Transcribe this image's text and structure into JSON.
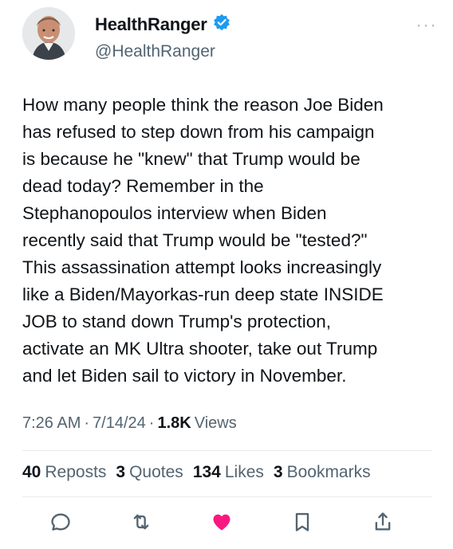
{
  "author": {
    "name": "HealthRanger",
    "handle": "@HealthRanger",
    "verified_badge_icon": "verified-badge-icon",
    "more_icon": "more-options-icon"
  },
  "tweet": {
    "text": "How many people think the reason Joe Biden\nhas refused to step down from his campaign\nis because he \"knew\" that Trump would be\ndead today? Remember in the\nStephanopoulos interview when Biden\nrecently said that Trump would be \"tested?\"\nThis assassination attempt looks increasingly\nlike a Biden/Mayorkas-run deep state INSIDE\nJOB to stand down Trump's protection,\nactivate an MK Ultra shooter, take out Trump\nand let Biden sail to victory in November."
  },
  "meta": {
    "time": "7:26 AM",
    "separator1": "·",
    "date": "7/14/24",
    "separator2": "·",
    "views_count": "1.8K",
    "views_label": "Views"
  },
  "stats": {
    "reposts_count": "40",
    "reposts_label": "Reposts",
    "quotes_count": "3",
    "quotes_label": "Quotes",
    "likes_count": "134",
    "likes_label": "Likes",
    "bookmarks_count": "3",
    "bookmarks_label": "Bookmarks"
  },
  "colors": {
    "verified": "#1d9bf0",
    "like_active": "#f91880",
    "icon_gray": "#536471"
  }
}
